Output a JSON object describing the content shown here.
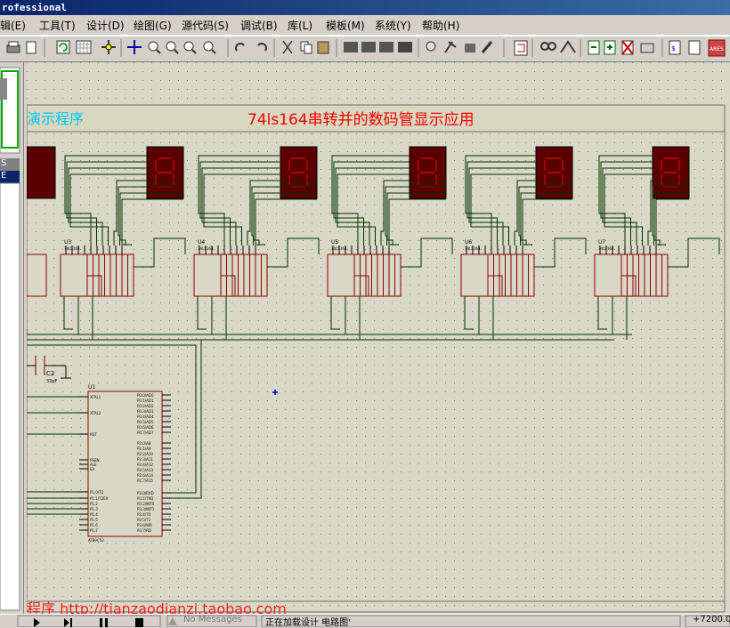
{
  "window": {
    "title": "rofessional"
  },
  "menu": [
    "辑(E)",
    "工具(T)",
    "设计(D)",
    "绘图(G)",
    "源代码(S)",
    "调试(B)",
    "库(L)",
    "模板(M)",
    "系统(Y)",
    "帮助(H)"
  ],
  "toolbar_icons": [
    "print-icon",
    "page-icon",
    "refresh-icon",
    "grid-icon",
    "origin-icon",
    "pan-icon",
    "zoom-in-icon",
    "zoom-out-icon",
    "zoom-all-icon",
    "zoom-area-icon",
    "undo-icon",
    "redo-icon",
    "cut-icon",
    "copy-icon",
    "paste-icon",
    "block-copy-icon",
    "block-move-icon",
    "block-rotate-icon",
    "block-delete-icon",
    "pick-device-icon",
    "make-device-icon",
    "packaging-icon",
    "decompose-icon",
    "wire-autoroute-icon",
    "search-icon",
    "property-icon",
    "new-sheet-icon",
    "delete-sheet-icon",
    "zoom-to-child-icon",
    "bom-icon",
    "erc-icon",
    "ares-icon"
  ],
  "left_panel": {
    "mode_labels": [
      "S",
      "E"
    ]
  },
  "schematic": {
    "banner_left": "演示程序",
    "banner_title": "74ls164串转并的数码管显示应用",
    "chips": [
      "U3",
      "U4",
      "U5",
      "U6",
      "U7"
    ],
    "chip_part": "74LS164",
    "mcu_ref": "U1",
    "mcu_part": "AT89C52",
    "mcu_left_pins": [
      "XTAL1",
      "XTAL2",
      "RST",
      "PSEN",
      "ALE",
      "EA",
      "P1.0/T2",
      "P1.1/T2EX",
      "P1.2",
      "P1.3",
      "P1.4",
      "P1.5",
      "P1.6",
      "P1.7"
    ],
    "mcu_right_pins": [
      "P0.0/AD0",
      "P0.1/AD1",
      "P0.2/AD2",
      "P0.3/AD3",
      "P0.4/AD4",
      "P0.5/AD5",
      "P0.6/AD6",
      "P0.7/AD7",
      "P2.0/A8",
      "P2.1/A9",
      "P2.2/A10",
      "P2.3/A11",
      "P2.4/A12",
      "P2.5/A13",
      "P2.6/A14",
      "P2.7/A15",
      "P3.0/RXD",
      "P3.1/TXD",
      "P3.2/INT0",
      "P3.3/INT1",
      "P3.4/T0",
      "P3.5/T1",
      "P3.6/WR",
      "P3.7/RD"
    ],
    "cap_ref": "C2",
    "cap_value": "33pF",
    "footer_text": "程序 http://tianzaodianzi.taobao.com"
  },
  "status": {
    "messages": "No Messages",
    "text": "正在加载设计 电路图'",
    "coord": "+7200.0"
  }
}
